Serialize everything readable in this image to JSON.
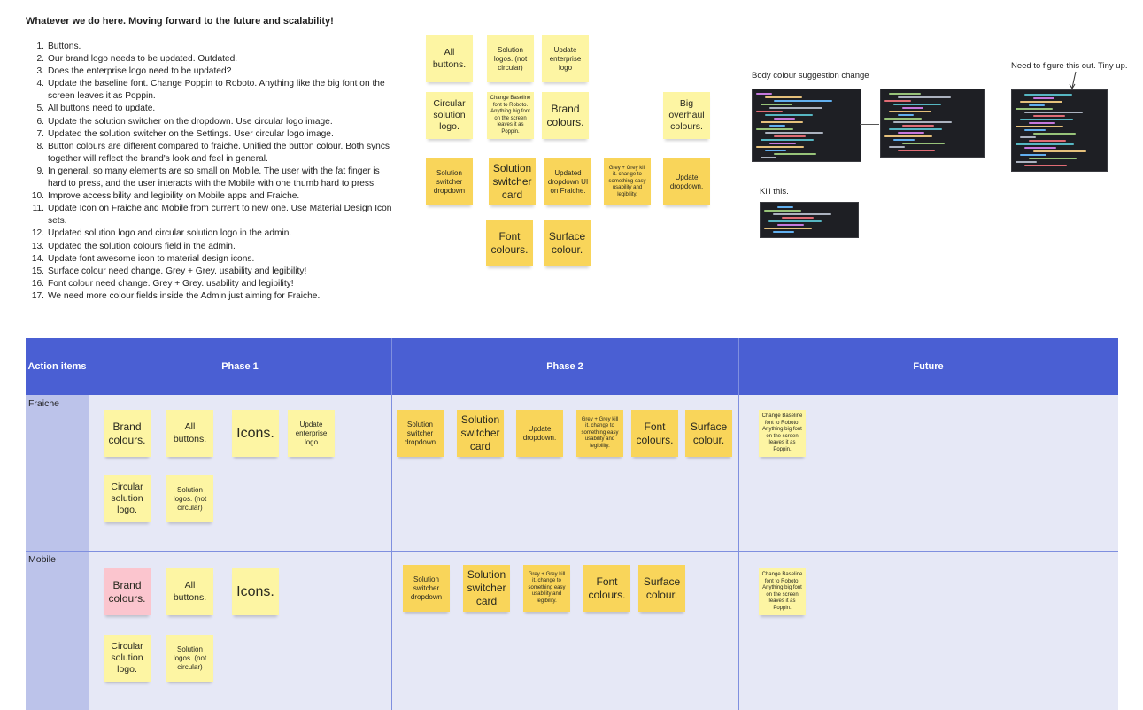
{
  "board": {
    "heading": "Whatever we do here. Moving forward to the future and scalability!",
    "todo": [
      {
        "n": "1.",
        "t": "Buttons."
      },
      {
        "n": "2.",
        "t": "Our brand logo needs to be updated. Outdated."
      },
      {
        "n": "3.",
        "t": "Does the enterprise logo need to be updated?"
      },
      {
        "n": "4.",
        "t": "Update the baseline font. Change Poppin to Roboto. Anything like the big font on the screen leaves it as Poppin."
      },
      {
        "n": "5.",
        "t": "All buttons need to update."
      },
      {
        "n": "6.",
        "t": "Update the solution switcher on the dropdown. Use circular logo image."
      },
      {
        "n": "7.",
        "t": "Updated the solution switcher on the Settings. User circular logo image."
      },
      {
        "n": "8.",
        "t": "Button colours are different compared to fraiche. Unified the button colour. Both syncs together will reflect the brand's look and feel in general."
      },
      {
        "n": "9.",
        "t": "In general, so many elements are so small on Mobile. The user with the fat finger is hard to press, and the user interacts with the Mobile with one thumb hard to press."
      },
      {
        "n": "10.",
        "t": "Improve accessibility and legibility on Mobile apps and Fraiche."
      },
      {
        "n": "11.",
        "t": "Update Icon on Fraiche and Mobile from current to new one. Use Material Design Icon sets."
      },
      {
        "n": "12.",
        "t": "Updated solution logo and circular solution logo in the admin."
      },
      {
        "n": "13.",
        "t": "Updated the solution colours field in the admin."
      },
      {
        "n": "14.",
        "t": "Update font awesome icon to material design icons."
      },
      {
        "n": "15.",
        "t": "Surface colour need change. Grey + Grey. usability and legibility!"
      },
      {
        "n": "16.",
        "t": "Font colour need change. Grey + Grey. usability and legibility!"
      },
      {
        "n": "17.",
        "t": "We need more colour fields inside the Admin just aiming for Fraiche."
      }
    ],
    "stickies": {
      "all_buttons": "All buttons.",
      "solution_logos": "Solution logos. (not circular)",
      "update_enterprise_logo": "Update enterprise logo",
      "circular_solution_logo": "Circular solution logo.",
      "change_baseline_font": "Change Baseline font to Roboto. Anything big font on the screen leaves it as Poppin.",
      "brand_colours": "Brand colours.",
      "big_overhaul_colours": "Big overhaul colours.",
      "solution_switcher_dropdown": "Solution switcher dropdown",
      "solution_switcher_card": "Solution switcher card",
      "updated_dropdown_ui": "Updated dropdown UI on Fraiche.",
      "grey_grey_kill": "Grey + Grey kill it. change to something easy usability and legibility.",
      "update_dropdown": "Update dropdown.",
      "font_colours": "Font colours.",
      "surface_colour": "Surface colour.",
      "icons": "Icons."
    },
    "captions": {
      "body_colour": "Body colour suggestion change",
      "figure_out": "Need to figure this out. Tiny up.",
      "kill_this": "Kill this."
    }
  },
  "table": {
    "headers": {
      "action_items": "Action items",
      "phase1": "Phase 1",
      "phase2": "Phase 2",
      "future": "Future"
    },
    "rows": {
      "fraiche": "Fraiche",
      "mobile": "Mobile"
    }
  },
  "colors": {
    "header_blue": "#4a5fd3",
    "row_label": "#bcc3ea",
    "cell_bg": "#e6e8f6",
    "sticky_light": "#fdf5a3",
    "sticky_amber": "#f9d55a",
    "sticky_pink": "#fbc5ce"
  }
}
